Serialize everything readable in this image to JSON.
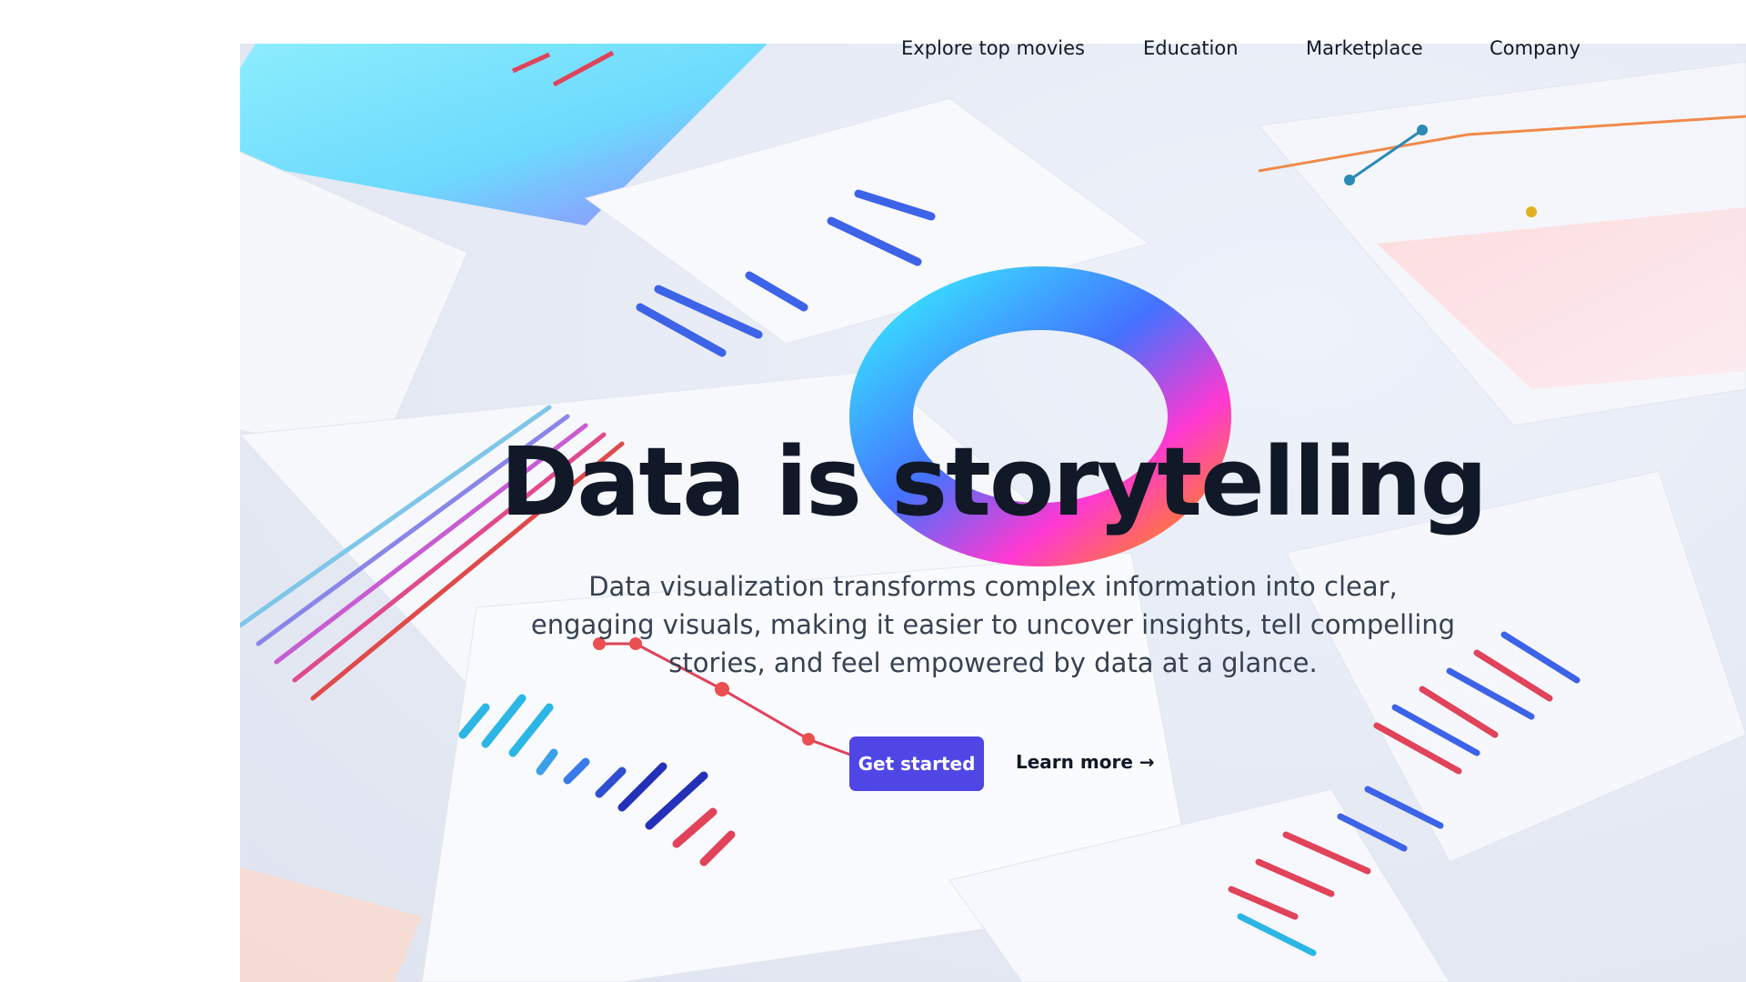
{
  "nav": {
    "items": [
      {
        "label": "Explore top movies"
      },
      {
        "label": "Education"
      },
      {
        "label": "Marketplace"
      },
      {
        "label": "Company"
      }
    ]
  },
  "hero": {
    "title": "Data is storytelling",
    "description": "Data visualization transforms complex information into clear, engaging visuals, making it easier to uncover insights, tell compelling stories, and feel empowered by data at a glance.",
    "primary_button": "Get started",
    "secondary_link": "Learn more →"
  },
  "colors": {
    "accent": "#4f46e5",
    "text_dark": "#111827",
    "text_body": "#374151"
  }
}
